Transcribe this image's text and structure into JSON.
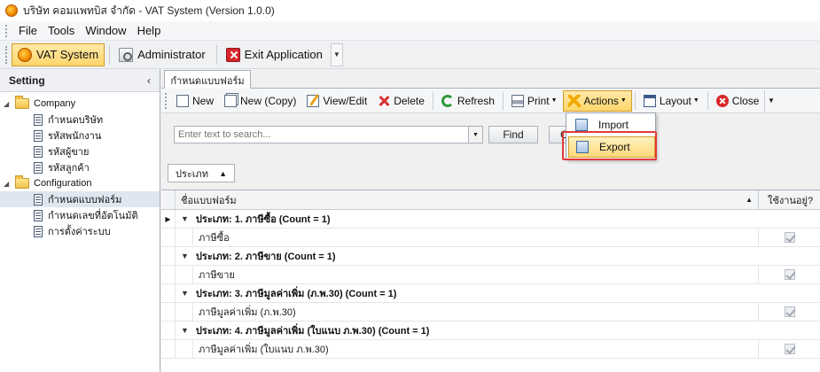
{
  "window": {
    "title": "บริษัท คอมแพทบิส จำกัด - VAT System (Version 1.0.0)"
  },
  "menubar": {
    "items": [
      "File",
      "Tools",
      "Window",
      "Help"
    ]
  },
  "appbar": {
    "vat_label": "VAT System",
    "admin_label": "Administrator",
    "exit_label": "Exit Application"
  },
  "sidebar": {
    "title": "Setting",
    "collapse_glyph": "‹",
    "company": "Company",
    "company_items": [
      "กำหนดบริษัท",
      "รหัสพนักงาน",
      "รหัสผู้ขาย",
      "รหัสลูกค้า"
    ],
    "configuration": "Configuration",
    "configuration_items": [
      "กำหนดแบบฟอร์ม",
      "กำหนดเลขที่อัตโนมัติ",
      "การตั้งค่าระบบ"
    ]
  },
  "tab": {
    "label": "กำหนดแบบฟอร์ม"
  },
  "toolbar": {
    "new": "New",
    "new_copy": "New (Copy)",
    "view_edit": "View/Edit",
    "delete": "Delete",
    "refresh": "Refresh",
    "print": "Print",
    "actions": "Actions",
    "layout": "Layout",
    "close": "Close"
  },
  "search": {
    "placeholder": "Enter text to search...",
    "find": "Find",
    "clear": "Clear"
  },
  "group_panel": {
    "chip": "ประเภท"
  },
  "grid": {
    "col_name": "ชื่อแบบฟอร์ม",
    "col_active": "ใช้งานอยู่?",
    "groups": [
      {
        "header": "ประเภท: 1. ภาษีซื้อ (Count = 1)",
        "row": "ภาษีซื้อ"
      },
      {
        "header": "ประเภท: 2. ภาษีขาย (Count = 1)",
        "row": "ภาษีขาย"
      },
      {
        "header": "ประเภท: 3. ภาษีมูลค่าเพิ่ม (ภ.พ.30) (Count = 1)",
        "row": "ภาษีมูลค่าเพิ่ม (ภ.พ.30)"
      },
      {
        "header": "ประเภท: 4. ภาษีมูลค่าเพิ่ม (ใบแนบ ภ.พ.30) (Count = 1)",
        "row": "ภาษีมูลค่าเพิ่ม (ใบแนบ ภ.พ.30)"
      }
    ]
  },
  "actions_menu": {
    "import": "Import",
    "export": "Export"
  },
  "colors": {
    "highlight": "#ffd66b",
    "highlight_border": "#d49b25",
    "callout": "#e23b3b"
  }
}
